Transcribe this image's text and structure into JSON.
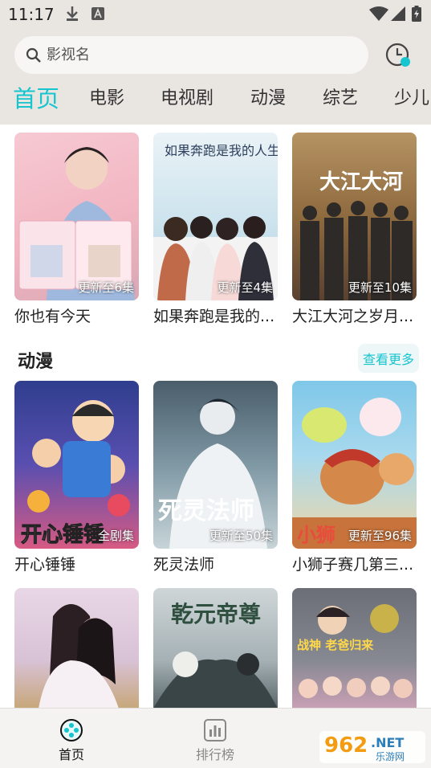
{
  "status": {
    "time": "11:17"
  },
  "search": {
    "placeholder": "影视名"
  },
  "tabs": [
    {
      "label": "首页",
      "active": true
    },
    {
      "label": "电影"
    },
    {
      "label": "电视剧"
    },
    {
      "label": "动漫"
    },
    {
      "label": "综艺"
    },
    {
      "label": "少儿"
    }
  ],
  "row1": [
    {
      "title": "你也有今天",
      "badge": "更新至6集"
    },
    {
      "title": "如果奔跑是我的...",
      "badge": "更新至4集"
    },
    {
      "title": "大江大河之岁月...",
      "badge": "更新至10集"
    }
  ],
  "anime": {
    "heading": "动漫",
    "more": "查看更多",
    "items": [
      {
        "title": "开心锤锤",
        "badge": "全剧集"
      },
      {
        "title": "死灵法师",
        "badge": "更新至50集"
      },
      {
        "title": "小狮子赛几第三...",
        "badge": "更新至96集"
      }
    ]
  },
  "poster_text": {
    "p2_art": "如果奔跑是我的人生",
    "p3_art": "大江大河",
    "a1_art": "开心锤锤",
    "a2_art": "死灵法师",
    "a3_art": "小狮",
    "r3_p2": "乾元帝尊",
    "r3_p3": "战神 老爸归来"
  },
  "nav": [
    {
      "label": "首页",
      "active": true
    },
    {
      "label": "排行榜"
    }
  ],
  "watermark": {
    "num": "962",
    "net": ".NET",
    "sub": "乐游网"
  },
  "colors": {
    "accent": "#17c5cf",
    "header_bg": "#e9e6e1"
  }
}
